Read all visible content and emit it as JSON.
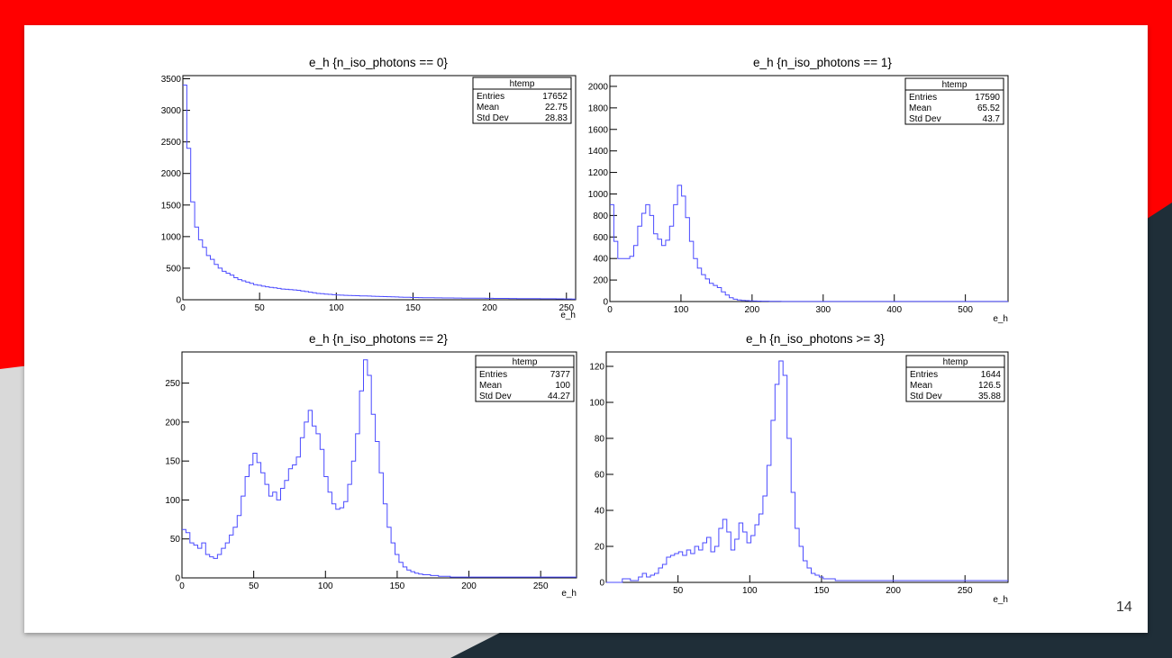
{
  "theme": {
    "accent": "#ff0000",
    "dark": "#1f2e38",
    "light_gray": "#d9d9d9",
    "line_color": "#4a4aff"
  },
  "slide": {
    "page_number": "14"
  },
  "chart_data": [
    {
      "type": "histogram",
      "title": "e_h {n_iso_photons == 0}",
      "xlabel": "e_h",
      "xlim": [
        0,
        256
      ],
      "ylim": [
        0,
        3550
      ],
      "xticks": [
        0,
        50,
        100,
        150,
        200,
        250
      ],
      "yticks": [
        0,
        500,
        1000,
        1500,
        2000,
        2500,
        3000,
        3500
      ],
      "bin_width": 2.56,
      "bin_values": [
        3400,
        2400,
        1550,
        1150,
        950,
        830,
        700,
        640,
        560,
        500,
        450,
        420,
        390,
        350,
        320,
        300,
        280,
        260,
        240,
        230,
        215,
        205,
        195,
        190,
        180,
        170,
        165,
        160,
        155,
        150,
        140,
        130,
        120,
        110,
        100,
        95,
        90,
        85,
        80,
        75,
        72,
        70,
        68,
        66,
        64,
        62,
        60,
        58,
        56,
        54,
        52,
        50,
        48,
        46,
        44,
        42,
        40,
        38,
        36,
        35,
        34,
        33,
        32,
        31,
        30,
        30,
        29,
        28,
        28,
        27,
        27,
        26,
        26,
        25,
        25,
        24,
        24,
        23,
        23,
        22,
        22,
        21,
        21,
        20,
        20,
        19,
        19,
        18,
        18,
        17,
        17,
        16,
        16,
        15,
        15,
        14,
        14,
        13,
        13,
        12
      ],
      "stats": {
        "name": "htemp",
        "entries": "17652",
        "mean": "22.75",
        "std_dev": "28.83"
      }
    },
    {
      "type": "histogram",
      "title": "e_h {n_iso_photons == 1}",
      "xlabel": "e_h",
      "xlim": [
        0,
        560
      ],
      "ylim": [
        0,
        2100
      ],
      "xticks": [
        0,
        100,
        200,
        300,
        400,
        500
      ],
      "yticks": [
        0,
        200,
        400,
        600,
        800,
        1000,
        1200,
        1400,
        1600,
        1800,
        2000
      ],
      "bin_width": 5.6,
      "bin_values": [
        900,
        560,
        400,
        400,
        400,
        420,
        520,
        700,
        820,
        900,
        800,
        630,
        580,
        520,
        570,
        700,
        900,
        1080,
        980,
        780,
        560,
        400,
        310,
        250,
        210,
        170,
        150,
        130,
        90,
        60,
        35,
        22,
        15,
        10,
        8,
        6,
        5,
        4,
        3,
        3,
        2,
        2,
        2,
        1,
        1,
        1,
        1,
        1,
        1,
        1,
        1,
        1,
        1,
        1,
        1,
        1,
        1,
        1,
        1,
        1,
        1,
        1,
        1,
        1,
        1,
        1,
        1,
        1,
        1,
        1,
        1,
        1,
        1,
        1,
        1,
        1,
        1,
        1,
        1,
        1,
        1,
        1,
        1,
        1,
        1,
        1,
        1,
        1,
        1,
        1,
        1,
        1,
        1,
        1,
        1,
        1,
        1,
        1,
        1,
        1
      ],
      "stats": {
        "name": "htemp",
        "entries": "17590",
        "mean": "65.52",
        "std_dev": "43.7"
      }
    },
    {
      "type": "histogram",
      "title": "e_h {n_iso_photons == 2}",
      "xlabel": "e_h",
      "xlim": [
        0,
        275
      ],
      "ylim": [
        0,
        290
      ],
      "xticks": [
        0,
        50,
        100,
        150,
        200,
        250
      ],
      "yticks": [
        0,
        50,
        100,
        150,
        200,
        250
      ],
      "bin_width": 2.75,
      "bin_values": [
        62,
        58,
        45,
        42,
        38,
        45,
        30,
        27,
        25,
        30,
        38,
        45,
        55,
        65,
        80,
        105,
        130,
        145,
        160,
        148,
        135,
        120,
        105,
        110,
        100,
        115,
        125,
        140,
        145,
        155,
        180,
        200,
        215,
        195,
        185,
        165,
        130,
        110,
        95,
        88,
        90,
        98,
        120,
        150,
        185,
        240,
        280,
        260,
        210,
        175,
        135,
        95,
        65,
        45,
        30,
        20,
        14,
        10,
        8,
        6,
        5,
        4,
        4,
        3,
        3,
        2,
        2,
        2,
        1,
        1,
        1,
        1,
        1,
        1,
        1,
        1,
        1,
        1,
        1,
        1,
        1,
        1,
        1,
        1,
        1,
        1,
        1,
        1,
        1,
        1,
        1,
        1,
        1,
        1,
        1,
        1,
        1,
        1,
        1,
        1
      ],
      "stats": {
        "name": "htemp",
        "entries": "7377",
        "mean": "100",
        "std_dev": "44.27"
      }
    },
    {
      "type": "histogram",
      "title": "e_h {n_iso_photons >= 3}",
      "xlabel": "e_h",
      "xlim": [
        0,
        280
      ],
      "ylim": [
        0,
        128
      ],
      "xticks": [
        50,
        100,
        150,
        200,
        250
      ],
      "yticks": [
        0,
        20,
        40,
        60,
        80,
        100,
        120
      ],
      "bin_width": 2.8,
      "bin_values": [
        0,
        0,
        0,
        0,
        2,
        2,
        1,
        1,
        3,
        5,
        3,
        4,
        5,
        8,
        10,
        14,
        15,
        16,
        17,
        15,
        18,
        16,
        20,
        18,
        22,
        25,
        17,
        20,
        30,
        35,
        28,
        18,
        24,
        33,
        28,
        22,
        26,
        32,
        38,
        48,
        65,
        90,
        110,
        123,
        115,
        80,
        50,
        30,
        20,
        12,
        8,
        5,
        4,
        3,
        2,
        2,
        2,
        1,
        1,
        1,
        1,
        1,
        1,
        1,
        1,
        1,
        1,
        1,
        1,
        1,
        1,
        1,
        1,
        1,
        1,
        1,
        1,
        1,
        1,
        1,
        1,
        1,
        1,
        1,
        1,
        1,
        1,
        1,
        1,
        1,
        1,
        1,
        1,
        1,
        1,
        1,
        1,
        1,
        1,
        1
      ],
      "stats": {
        "name": "htemp",
        "entries": "1644",
        "mean": "126.5",
        "std_dev": "35.88"
      }
    }
  ]
}
